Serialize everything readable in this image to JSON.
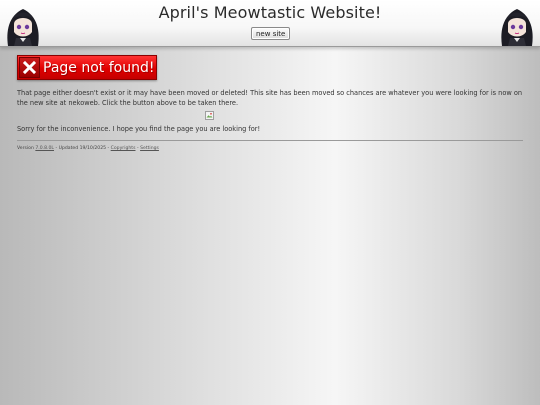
{
  "header": {
    "title": "April's Meowtastic Website!",
    "new_site_label": "new site",
    "mascot_left_icon": "anime-girl-icon",
    "mascot_right_icon": "anime-girl-icon"
  },
  "error": {
    "icon": "x-close-icon",
    "title": "Page not found!",
    "color": "#e00000"
  },
  "content": {
    "paragraph1": "That page either doesn't exist or it may have been moved or deleted! This site has been moved so chances are whatever you were looking for is now on the new site at nekoweb. Click the button above to be taken there.",
    "broken_image_icon": "broken-image-icon",
    "paragraph2": "Sorry for the inconvenience. I hope you find the page you are looking for!"
  },
  "footer": {
    "version_prefix": "Version ",
    "version_link": "7.0.8.0L",
    "updated_text": " - Updated 19/10/2025 - ",
    "copyrights_link": "Copyrights",
    "separator": " - ",
    "settings_link": "Settings"
  }
}
